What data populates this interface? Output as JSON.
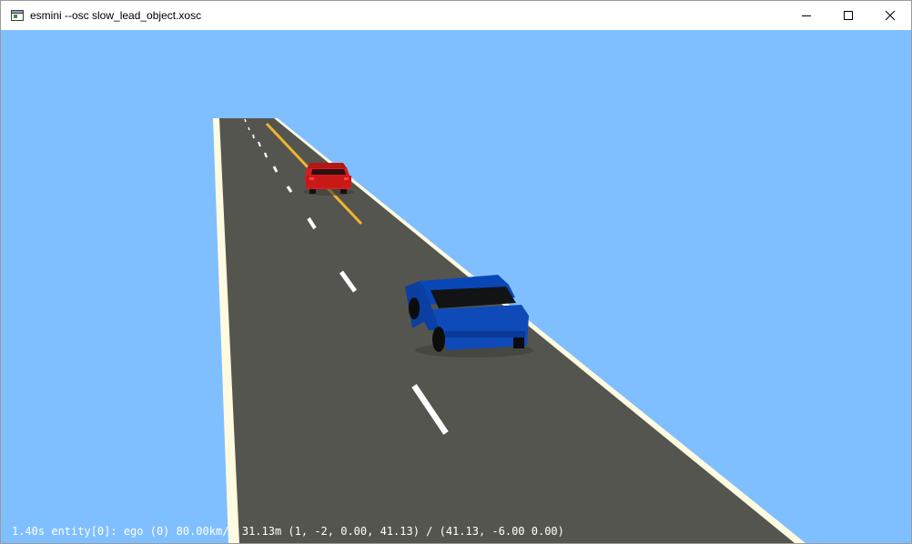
{
  "window": {
    "title": "esmini --osc slow_lead_object.xosc",
    "app_icon": "window-app-icon",
    "controls": [
      "minimize-icon",
      "maximize-icon",
      "close-icon"
    ]
  },
  "viewport": {
    "sky_color": "#80bfff",
    "road_color": "#55554f",
    "road_edge_color": "#fffbe0",
    "lane_marking_color": "#ffffff",
    "center_line_color": "#f0b430",
    "ego_car_color": "#0b45b0",
    "lead_car_color": "#cc1a1a"
  },
  "status": {
    "text": "1.40s entity[0]: ego (0) 80.00km/h 31.13m (1, -2, 0.00, 41.13) / (41.13, -6.00 0.00)"
  }
}
